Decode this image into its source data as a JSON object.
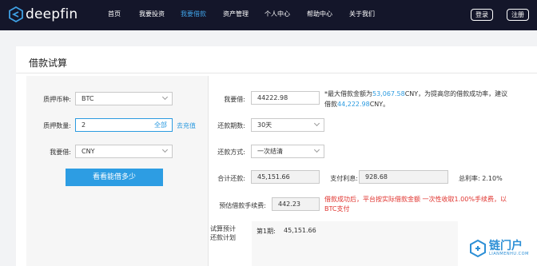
{
  "brand": {
    "name": "deepfin"
  },
  "nav": {
    "items": [
      "首页",
      "我要投资",
      "我要借款",
      "资产管理",
      "个人中心",
      "帮助中心",
      "关于我们"
    ],
    "active": "我要借款",
    "login": "登录",
    "register": "注册"
  },
  "page": {
    "title": "借款试算"
  },
  "form_left": {
    "collateral_label": "质押币种:",
    "collateral_value": "BTC",
    "quantity_label": "质押数量:",
    "quantity_value": "2",
    "quantity_all": "全部",
    "recharge_link": "去充值",
    "borrow_currency_label": "我要借:",
    "borrow_currency_value": "CNY",
    "calc_button": "看看能借多少"
  },
  "form_right": {
    "amount_label": "我要借:",
    "amount_value": "44222.98",
    "hint_prefix": "*最大借款金额为",
    "hint_max": "53,067.58",
    "hint_mid": "CNY，为提高您的借款成功率，建议借款",
    "hint_suggest": "44,222.98",
    "hint_suffix": "CNY。",
    "period_label": "还款期数:",
    "period_value": "30天",
    "method_label": "还款方式:",
    "method_value": "一次结清",
    "total_label": "合计还款:",
    "total_value": "45,151.66",
    "interest_label": "支付利息:",
    "interest_value": "928.68",
    "rate_label": "总利率:",
    "rate_value": "2.10%",
    "fee_label": "预估借款手续费:",
    "fee_value": "442.23",
    "fee_warning": "借款成功后，平台按实际借款金额 一次性收取1.00%手续费，以BTC支付",
    "plan_label_1": "试算预计",
    "plan_label_2": "还款计划",
    "plan_period": "第1期:",
    "plan_amount": "45,151.66"
  },
  "watermark": {
    "main": "链门户",
    "sub": "LIANMENHU.COM"
  },
  "colors": {
    "nav_bg": "#14162a",
    "accent": "#2d9de3",
    "warning": "#e0342f"
  }
}
